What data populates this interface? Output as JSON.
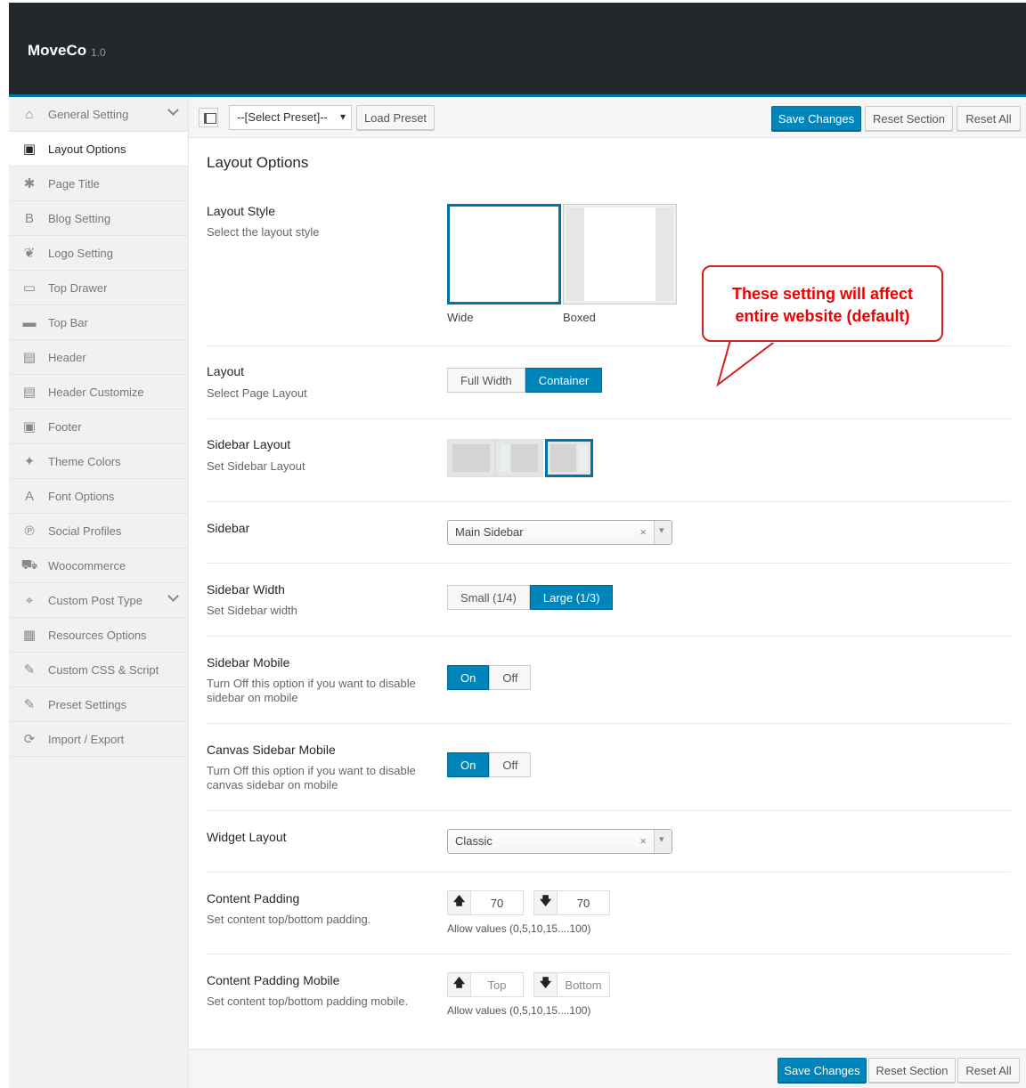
{
  "app": {
    "name": "MoveCo",
    "version": "1.0"
  },
  "sidebar": {
    "items": [
      {
        "label": "General Setting",
        "icon": "home-icon",
        "glyph": "⌂",
        "expandable": true
      },
      {
        "label": "Layout Options",
        "icon": "layout-icon",
        "glyph": "▣",
        "active": true
      },
      {
        "label": "Page Title",
        "icon": "asterisk-icon",
        "glyph": "✱"
      },
      {
        "label": "Blog Setting",
        "icon": "blog-icon",
        "glyph": "B"
      },
      {
        "label": "Logo Setting",
        "icon": "leaf-icon",
        "glyph": "❦"
      },
      {
        "label": "Top Drawer",
        "icon": "drawer-icon",
        "glyph": "▭"
      },
      {
        "label": "Top Bar",
        "icon": "minus-icon",
        "glyph": "▬"
      },
      {
        "label": "Header",
        "icon": "header-icon",
        "glyph": "▤"
      },
      {
        "label": "Header Customize",
        "icon": "header-customize-icon",
        "glyph": "▤"
      },
      {
        "label": "Footer",
        "icon": "footer-icon",
        "glyph": "▣"
      },
      {
        "label": "Theme Colors",
        "icon": "magic-wand-icon",
        "glyph": "✦"
      },
      {
        "label": "Font Options",
        "icon": "font-icon",
        "glyph": "A"
      },
      {
        "label": "Social Profiles",
        "icon": "pinterest-icon",
        "glyph": "℗"
      },
      {
        "label": "Woocommerce",
        "icon": "cart-icon",
        "glyph": "⛟"
      },
      {
        "label": "Custom Post Type",
        "icon": "crosshair-icon",
        "glyph": "⌖",
        "expandable": true
      },
      {
        "label": "Resources Options",
        "icon": "grid-icon",
        "glyph": "▦"
      },
      {
        "label": "Custom CSS & Script",
        "icon": "edit-icon",
        "glyph": "✎"
      },
      {
        "label": "Preset Settings",
        "icon": "edit-icon",
        "glyph": "✎"
      },
      {
        "label": "Import / Export",
        "icon": "refresh-icon",
        "glyph": "⟳"
      }
    ]
  },
  "toolbar": {
    "preset_select": "--[Select Preset]--",
    "load_preset": "Load Preset",
    "save": "Save Changes",
    "reset_section": "Reset Section",
    "reset_all": "Reset All"
  },
  "section": {
    "title": "Layout Options"
  },
  "fields": {
    "layout_style": {
      "label": "Layout Style",
      "desc": "Select the layout style",
      "options": [
        "Wide",
        "Boxed"
      ],
      "selected": "Wide"
    },
    "layout": {
      "label": "Layout",
      "desc": "Select Page Layout",
      "options": [
        "Full Width",
        "Container"
      ],
      "selected": "Container"
    },
    "sidebar_layout": {
      "label": "Sidebar Layout",
      "desc": "Set Sidebar Layout"
    },
    "sidebar": {
      "label": "Sidebar",
      "value": "Main Sidebar"
    },
    "sidebar_width": {
      "label": "Sidebar Width",
      "desc": "Set Sidebar width",
      "options": [
        "Small (1/4)",
        "Large (1/3)"
      ],
      "selected": "Large (1/3)"
    },
    "sidebar_mobile": {
      "label": "Sidebar Mobile",
      "desc": "Turn Off this option if you want to disable sidebar on mobile",
      "on": "On",
      "off": "Off"
    },
    "canvas_sidebar_mobile": {
      "label": "Canvas Sidebar Mobile",
      "desc": "Turn Off this option if you want to disable canvas sidebar on mobile",
      "on": "On",
      "off": "Off"
    },
    "widget_layout": {
      "label": "Widget Layout",
      "value": "Classic"
    },
    "content_padding": {
      "label": "Content Padding",
      "desc": "Set content top/bottom padding.",
      "top": "70",
      "bottom": "70",
      "hint": "Allow values (0,5,10,15....100)"
    },
    "content_padding_mobile": {
      "label": "Content Padding Mobile",
      "desc": "Set content top/bottom padding mobile.",
      "top_placeholder": "Top",
      "bottom_placeholder": "Bottom",
      "hint": "Allow values (0,5,10,15....100)"
    }
  },
  "callout": {
    "line1": "These setting will affect",
    "line2": "entire website (default)",
    "color": "#e00000"
  },
  "colors": {
    "accent": "#0085ba",
    "header_bg": "#23282d"
  }
}
